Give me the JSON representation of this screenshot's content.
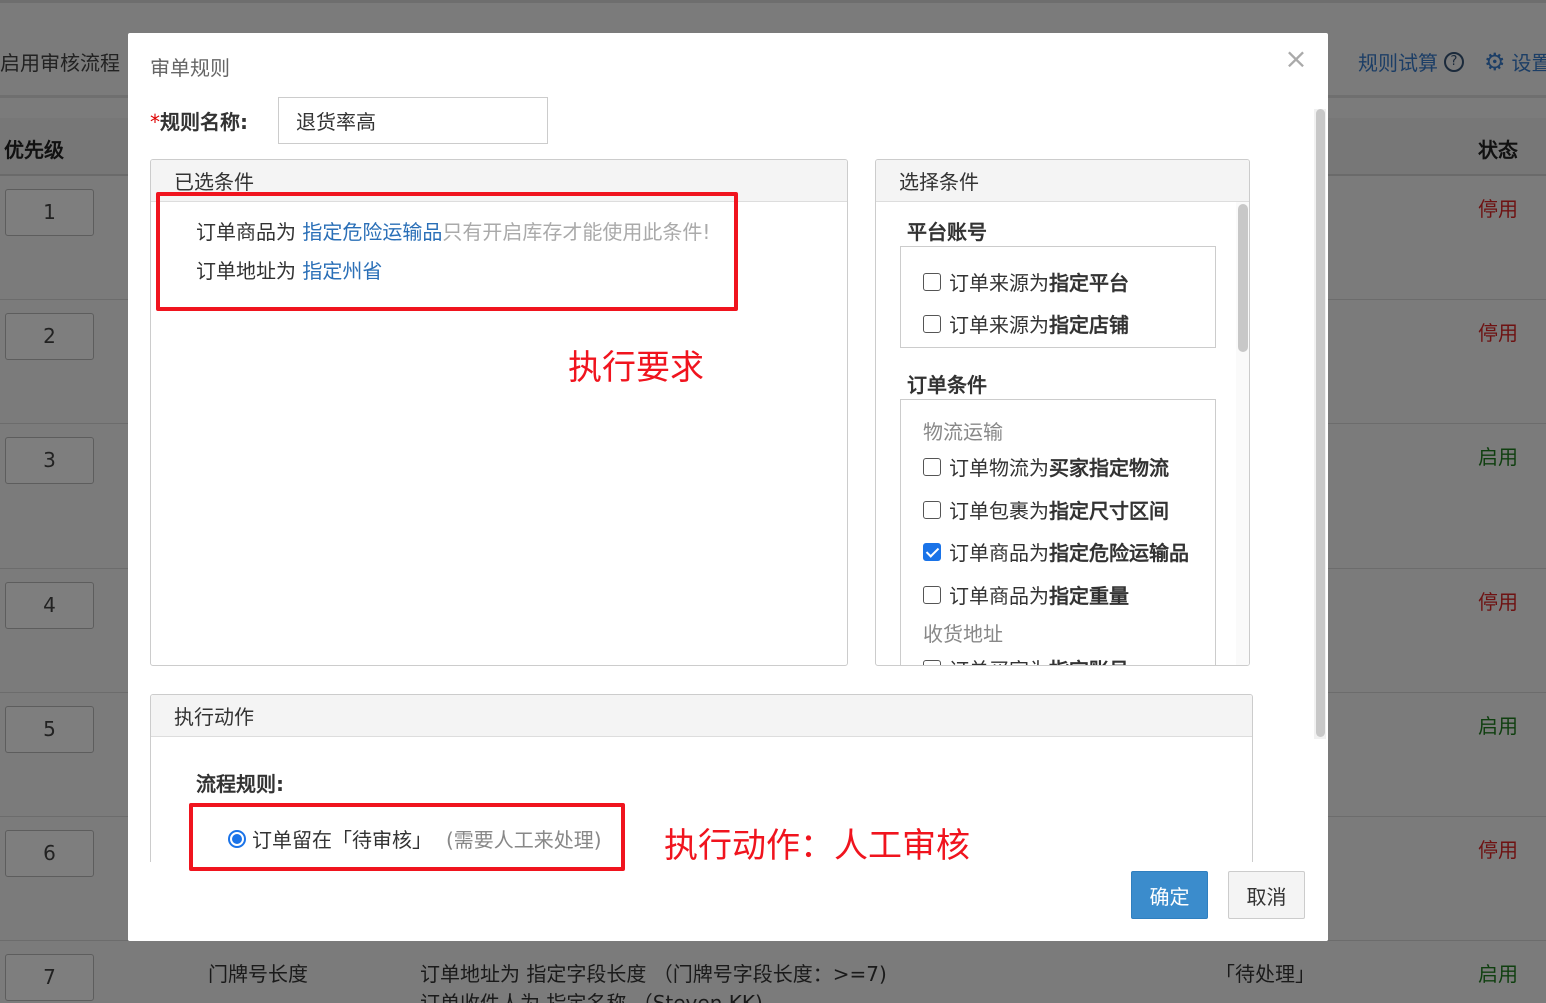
{
  "background": {
    "toggle_label": "启用审核流程",
    "links": {
      "trial": "规则试算",
      "help_icon": "?",
      "settings": "设置"
    },
    "headers": {
      "priority": "优先级",
      "status": "状态"
    },
    "rows": [
      {
        "priority": "1",
        "status": "停用"
      },
      {
        "priority": "2",
        "status": "停用"
      },
      {
        "priority": "3",
        "status": "启用"
      },
      {
        "priority": "4",
        "status": "停用"
      },
      {
        "priority": "5",
        "status": "启用"
      },
      {
        "priority": "6",
        "status": "停用"
      },
      {
        "priority": "7",
        "status": "启用",
        "name": "门牌号长度",
        "condition_1": "订单地址为 指定字段长度 （门牌号字段长度：>=7)",
        "condition_2": "订单收件人为 指定名称 （Steven KK)",
        "action": "「待处理」"
      }
    ],
    "colors": {
      "disabled": "#6e1212",
      "enabled": "#0f3f0f"
    }
  },
  "modal": {
    "title": "审单规则",
    "close_symbol": "×",
    "name_required_mark": "*",
    "name_label": "规则名称:",
    "name_value": "退货率高",
    "selected_panel": {
      "title": "已选条件",
      "conditions": [
        {
          "prefix": "订单商品为 ",
          "value": "指定危险运输品",
          "hint": "只有开启库存才能使用此条件!"
        },
        {
          "prefix": "订单地址为 ",
          "value": "指定州省",
          "hint": ""
        }
      ]
    },
    "choose_panel": {
      "title": "选择条件",
      "groups": [
        {
          "title": "平台账号",
          "items": [
            {
              "prefix": "订单来源为",
              "bold": "指定平台",
              "checked": false
            },
            {
              "prefix": "订单来源为",
              "bold": "指定店铺",
              "checked": false
            }
          ]
        },
        {
          "title": "订单条件",
          "subgroups": [
            {
              "title": "物流运输",
              "items": [
                {
                  "prefix": "订单物流为",
                  "bold": "买家指定物流",
                  "checked": false
                },
                {
                  "prefix": "订单包裹为",
                  "bold": "指定尺寸区间",
                  "checked": false
                },
                {
                  "prefix": "订单商品为",
                  "bold": "指定危险运输品",
                  "checked": true
                },
                {
                  "prefix": "订单商品为",
                  "bold": "指定重量",
                  "checked": false
                }
              ]
            },
            {
              "title": "收货地址",
              "items": [
                {
                  "prefix": "订单买家为",
                  "bold": "指定账号",
                  "checked": false
                }
              ]
            }
          ]
        }
      ]
    },
    "action_panel": {
      "title": "执行动作",
      "flow_label": "流程规则:",
      "option": {
        "label": "订单留在「待审核」",
        "note": "(需要人工来处理)",
        "selected": true
      }
    },
    "buttons": {
      "ok": "确定",
      "cancel": "取消"
    },
    "accent_color": "#3b8ccc"
  },
  "annotations": {
    "requirement": "执行要求",
    "action": "执行动作：人工审核",
    "color": "#f0141e"
  }
}
